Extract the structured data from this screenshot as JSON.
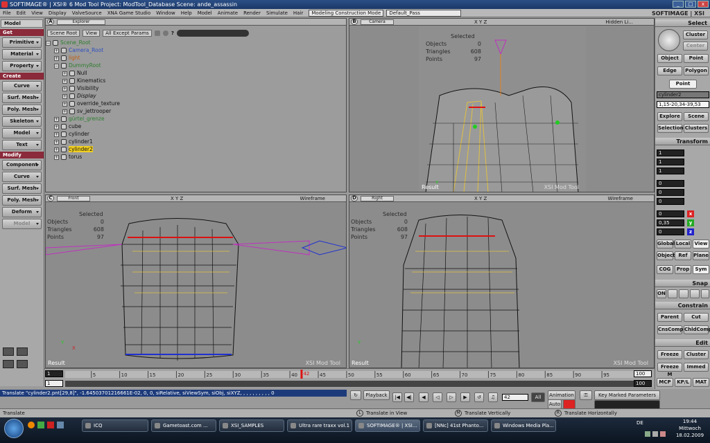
{
  "window": {
    "title": "SOFTIMAGE® | XSI® 6 Mod Tool Project: ModTool_Database   Scene: ande_assassin",
    "brand": "SOFTIMAGE | XSI"
  },
  "menu": {
    "items": [
      "File",
      "Edit",
      "View",
      "Display",
      "ValveSource",
      "XNA Game Studio",
      "Window",
      "Help",
      "Model",
      "Animate",
      "Render",
      "Simulate",
      "Hair"
    ],
    "mode": "Modeling Construction Mode",
    "pass": "Default_Pass"
  },
  "left": {
    "module": "Model",
    "get": "Get",
    "get_items": [
      "Primitive",
      "Material",
      "Property"
    ],
    "create": "Create",
    "create_items": [
      "Curve",
      "Surf. Mesh",
      "Poly. Mesh",
      "Skeleton",
      "Model",
      "Text"
    ],
    "modify": "Modify",
    "modify_items": [
      "Component",
      "Curve",
      "Surf. Mesh",
      "Poly. Mesh",
      "Deform",
      "Model"
    ]
  },
  "explorer": {
    "label": "A",
    "title": "Explorer",
    "scope": "Scene Root",
    "view": "View",
    "filter": "All Except Params",
    "tree": [
      {
        "t": "Scene_Root",
        "i": 0,
        "c": "#2e7d2e"
      },
      {
        "t": "Camera_Root",
        "i": 1,
        "c": "#3050c0"
      },
      {
        "t": "light",
        "i": 1,
        "c": "#c06010"
      },
      {
        "t": "DummyRoot",
        "i": 1,
        "c": "#2e7d2e"
      },
      {
        "t": "Null",
        "i": 2,
        "c": "#111"
      },
      {
        "t": "Kinematics",
        "i": 2,
        "c": "#111"
      },
      {
        "t": "Visibility",
        "i": 2,
        "c": "#111"
      },
      {
        "t": "Display",
        "i": 2,
        "c": "#111"
      },
      {
        "t": "override_texture",
        "i": 2,
        "c": "#111"
      },
      {
        "t": "sv_jettrooper",
        "i": 2,
        "c": "#111"
      },
      {
        "t": "gürtel_grenze",
        "i": 1,
        "c": "#2e7d2e"
      },
      {
        "t": "cube",
        "i": 1,
        "c": "#111"
      },
      {
        "t": "cylinder",
        "i": 1,
        "c": "#111"
      },
      {
        "t": "cylinder1",
        "i": 1,
        "c": "#111"
      },
      {
        "t": "cylinder2",
        "i": 1,
        "c": "#111",
        "sel": true
      },
      {
        "t": "torus",
        "i": 1,
        "c": "#111"
      }
    ]
  },
  "viewports": {
    "b": {
      "label": "B",
      "mode": "Camera",
      "xyz": "X Y Z",
      "shade": "Hidden Li..."
    },
    "c": {
      "label": "C",
      "mode": "Front",
      "xyz": "X Y Z",
      "shade": "Wireframe"
    },
    "d": {
      "label": "D",
      "mode": "Right",
      "xyz": "X Y Z",
      "shade": "Wireframe"
    },
    "stats": {
      "selected": "Selected",
      "objects_l": "Objects",
      "objects_v": "0",
      "tri_l": "Triangles",
      "tri_v": "608",
      "pts_l": "Points",
      "pts_v": "97"
    },
    "result": "Result",
    "xsi": "XSI Mod Tool"
  },
  "right": {
    "select": "Select",
    "cluster": "Cluster",
    "center": "Center",
    "object": "Object",
    "point": "Point",
    "edge": "Edge",
    "polygon": "Polygon",
    "point_active": "Point",
    "sel_name": "cylinder2",
    "sel_range": "1,15-20,34-39,53",
    "explore": "Explore",
    "scene": "Scene",
    "selection": "Selection",
    "clusters": "Clusters",
    "transform": "Transform",
    "scale_vals": [
      "1",
      "1",
      "1"
    ],
    "rot_vals": [
      "0",
      "0",
      "0"
    ],
    "trans_vals": [
      "0",
      "0,35",
      "0"
    ],
    "global": "Global",
    "local": "Local",
    "view": "View",
    "object2": "Object",
    "ref": "Ref",
    "plane": "Plane",
    "cog": "COG",
    "prop": "Prop",
    "sym": "Sym",
    "snap": "Snap",
    "on": "ON",
    "constrain": "Constrain",
    "parent": "Parent",
    "cut": "Cut",
    "cnscomp": "CnsComp",
    "chldcomp": "ChldComp",
    "edit": "Edit",
    "freeze": "Freeze",
    "cluster2": "Cluster",
    "freezem": "Freeze M",
    "immed": "Immed",
    "mcp": "MCP",
    "kpl": "KP/L",
    "mat": "MAT"
  },
  "timeline": {
    "start": "1",
    "end": "100",
    "end2": "100",
    "current": "42",
    "ticks": [
      "5",
      "10",
      "15",
      "20",
      "25",
      "30",
      "35",
      "40",
      "45",
      "50",
      "55",
      "60",
      "65",
      "70",
      "75",
      "80",
      "85",
      "90",
      "95"
    ],
    "start2": "1"
  },
  "playback": {
    "playback": "Playback",
    "frame": "42",
    "all": "All",
    "animation": "Animation",
    "auto": "Auto",
    "key_marked": "Key Marked Parameters"
  },
  "command": "Translate \"cylinder2.pnt[29,8]\", -1.64503701216661E-02, 0, 0, siRelative, siViewSym, siObj, siXYZ, , , , , , , , , , 0",
  "status": {
    "left": "Translate",
    "l": "Translate in View",
    "m": "Translate Vertically",
    "r": "Translate Horizontally"
  },
  "taskbar": {
    "items": [
      "ICQ",
      "Gametoast.com ...",
      "XSI_SAMPLES",
      "Ultra rare traxx vol.1",
      "SOFTIMAGE® | XSI...",
      "[NNc] 41st Phanto...",
      "Windows Media Pla..."
    ],
    "lang": "DE",
    "time": "19:44",
    "day": "Mittwoch",
    "date": "18.02.2009"
  },
  "colors": {
    "accent": "#8a2a3a",
    "select": "#f2d020",
    "wire": "#111111",
    "points": "#2030d0"
  }
}
